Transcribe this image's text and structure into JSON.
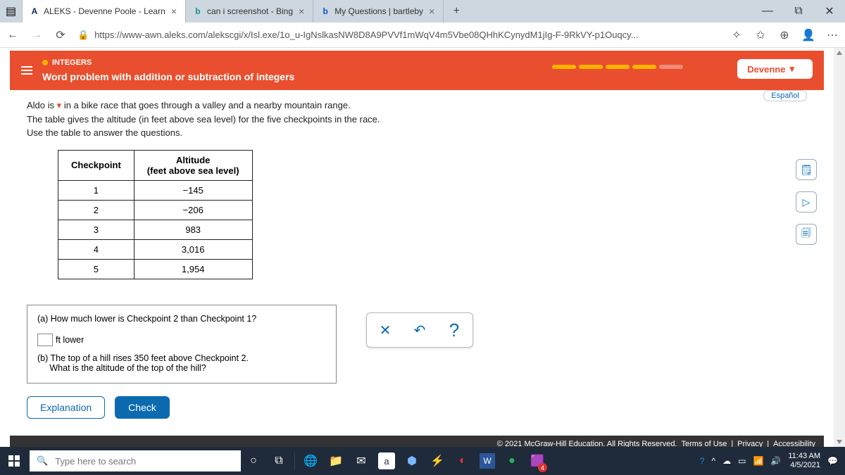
{
  "tabs": [
    {
      "title": "ALEKS - Devenne Poole - Learn",
      "fav": "A",
      "favcolor": "#0b2a57"
    },
    {
      "title": "can i screenshot - Bing",
      "fav": "b",
      "favcolor": "#1a8f8f"
    },
    {
      "title": "My Questions | bartleby",
      "fav": "b",
      "favcolor": "#0b57d0"
    }
  ],
  "url": "https://www-awn.aleks.com/alekscgi/x/Isl.exe/1o_u-IgNslkasNW8D8A9PVVf1mWqV4m5Vbe08QHhKCynydM1jIg-F-9RkVY-p1Ouqcy...",
  "aleks": {
    "crumb": "INTEGERS",
    "title": "Word problem with addition or subtraction of integers",
    "user": "Devenne"
  },
  "problem": {
    "name": "Aldo is",
    "rest1": "in a bike race that goes through a valley and a nearby mountain range.",
    "line2": "The table gives the altitude (in feet above sea level) for the five checkpoints in the race.",
    "line3": "Use the table to answer the questions.",
    "tbl_h1": "Checkpoint",
    "tbl_h2": "Altitude",
    "tbl_h2b": "(feet above sea level)"
  },
  "chart_data": {
    "type": "table",
    "rows": [
      {
        "cp": "1",
        "alt": "−145"
      },
      {
        "cp": "2",
        "alt": "−206"
      },
      {
        "cp": "3",
        "alt": "983"
      },
      {
        "cp": "4",
        "alt": "3,016"
      },
      {
        "cp": "5",
        "alt": "1,954"
      }
    ]
  },
  "q": {
    "a": "(a) How much lower is Checkpoint 2 than Checkpoint 1?",
    "a_unit": "ft lower",
    "b_lbl": "(b)",
    "b1": "The top of a hill rises 350 feet above Checkpoint 2.",
    "b2": "What is the altitude of the top of the hill?"
  },
  "btns": {
    "explain": "Explanation",
    "check": "Check"
  },
  "lang": "Español",
  "legal": {
    "copy": "© 2021 McGraw-Hill Education. All Rights Reserved.",
    "terms": "Terms of Use",
    "priv": "Privacy",
    "acc": "Accessibility"
  },
  "task": {
    "search": "Type here to search",
    "time": "11:43 AM",
    "date": "4/5/2021"
  }
}
